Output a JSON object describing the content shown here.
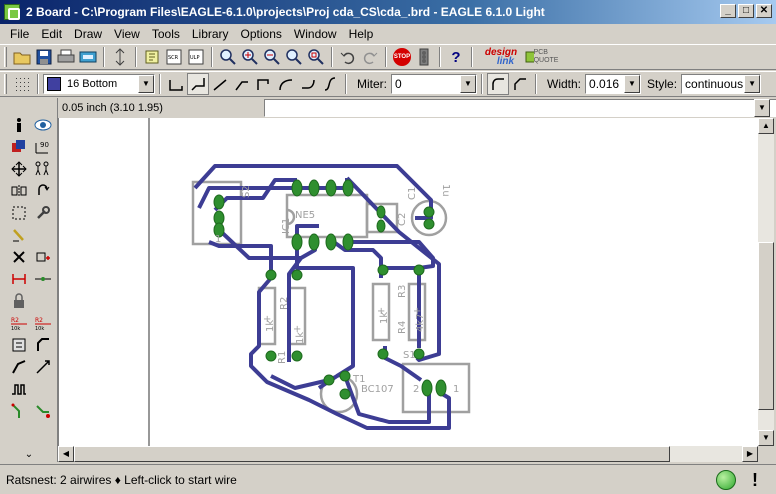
{
  "window": {
    "title": "2 Board - C:\\Program Files\\EAGLE-6.1.0\\projects\\Proj cda_CS\\cda_.brd - EAGLE 6.1.0 Light",
    "minimize": "_",
    "maximize": "□",
    "close": "✕"
  },
  "menu": [
    {
      "label": "File"
    },
    {
      "label": "Edit"
    },
    {
      "label": "Draw"
    },
    {
      "label": "View"
    },
    {
      "label": "Tools"
    },
    {
      "label": "Library"
    },
    {
      "label": "Options"
    },
    {
      "label": "Window"
    },
    {
      "label": "Help"
    }
  ],
  "toolbar": {
    "design_link_top": "design",
    "design_link_bottom": "link",
    "pcb_quote": "PCB QUOTE",
    "stop": "STOP"
  },
  "param_bar": {
    "layer": "16 Bottom",
    "layer_color": "#4040a0",
    "miter_label": "Miter:",
    "miter_value": "0",
    "width_label": "Width:",
    "width_value": "0.016",
    "style_label": "Style:",
    "style_value": "continuous"
  },
  "coords": "0.05 inch (3.10 1.95)",
  "board": {
    "labels": {
      "s2": "S2",
      "ic1": "IC1",
      "ne": "NE5",
      "c1": "C1",
      "c1_value": "1u",
      "c2": "C2",
      "r1": "R1",
      "r1_value": "1k",
      "r2": "R2",
      "r2_value": "1k",
      "r3": "R3",
      "r3_value": "1k",
      "r4": "R4",
      "r4_value": "4k7",
      "t1": "T1",
      "t1_value": "BC107",
      "s1": "S1",
      "s1_pin1": "1",
      "s1_pin2": "2",
      "s2_pin": "1",
      "plus": "+"
    },
    "trace_color": "#3d3d94",
    "pad_color": "#2f8f2f",
    "silk_color": "#a0a0a0"
  },
  "status": {
    "text": "Ratsnest: 2 airwires  ♦ Left-click to start wire",
    "indicator": "!"
  }
}
